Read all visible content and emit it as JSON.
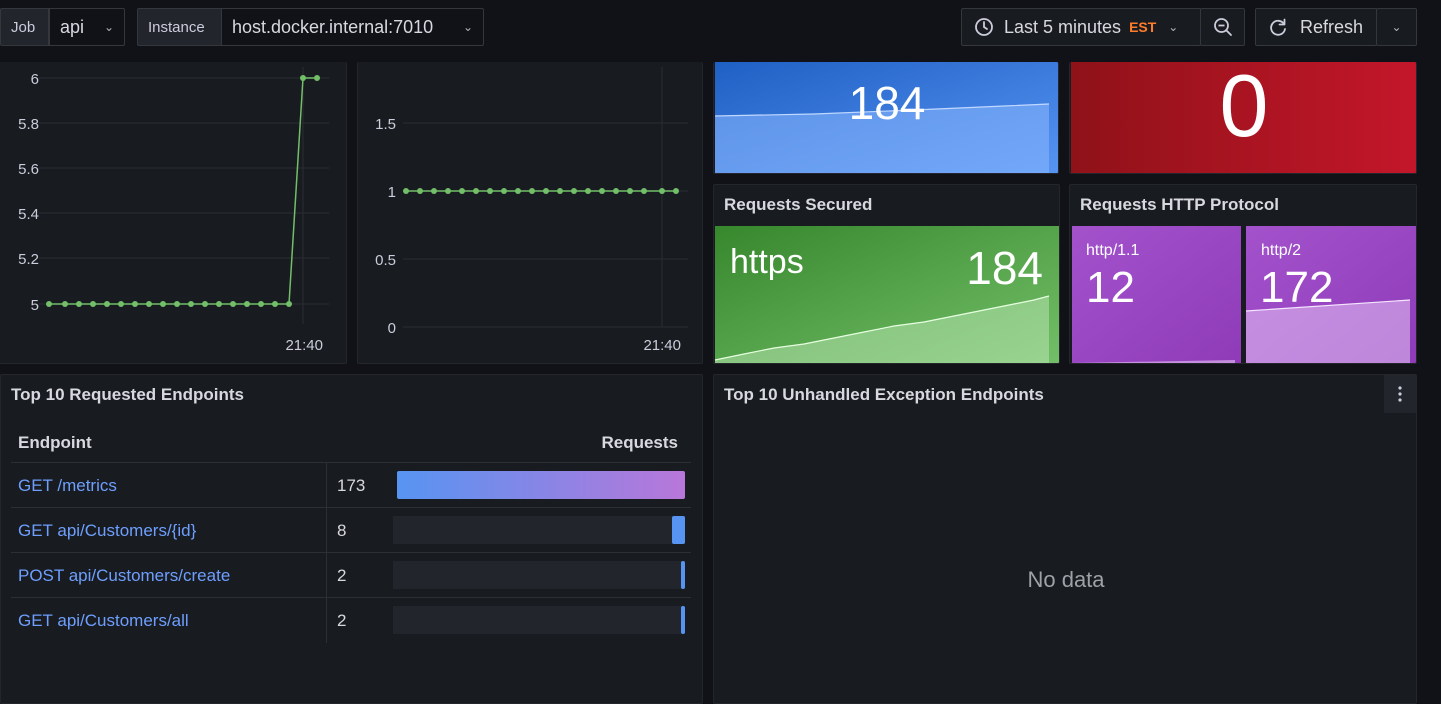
{
  "toolbar": {
    "job_label": "Job",
    "job_value": "api",
    "instance_label": "Instance",
    "instance_value": "host.docker.internal:7010",
    "time_range": "Last 5 minutes",
    "timezone": "EST",
    "refresh_label": "Refresh"
  },
  "panel_left_chart": {
    "y_ticks": [
      "6",
      "5.8",
      "5.6",
      "5.4",
      "5.2",
      "5"
    ],
    "x_tick": "21:40"
  },
  "panel_mid_chart": {
    "y_ticks": [
      "1.5",
      "1",
      "0.5",
      "0"
    ],
    "x_tick": "21:40"
  },
  "stat_total": {
    "value": "184"
  },
  "stat_errors": {
    "value": "0"
  },
  "requests_secured": {
    "title": "Requests Secured",
    "label": "https",
    "value": "184"
  },
  "requests_protocol": {
    "title": "Requests HTTP Protocol",
    "items": [
      {
        "label": "http/1.1",
        "value": "12"
      },
      {
        "label": "http/2",
        "value": "172"
      }
    ]
  },
  "top_requested": {
    "title": "Top 10 Requested Endpoints",
    "col_endpoint": "Endpoint",
    "col_requests": "Requests",
    "rows": [
      {
        "endpoint": "GET /metrics",
        "requests": "173",
        "fraction": 1.0
      },
      {
        "endpoint": "GET api/Customers/{id}",
        "requests": "8",
        "fraction": 0.046
      },
      {
        "endpoint": "POST api/Customers/create",
        "requests": "2",
        "fraction": 0.012
      },
      {
        "endpoint": "GET api/Customers/all",
        "requests": "2",
        "fraction": 0.012
      }
    ]
  },
  "top_exceptions": {
    "title": "Top 10 Unhandled Exception Endpoints",
    "empty_text": "No data"
  },
  "colors": {
    "green_line": "#73bf69",
    "blue_stat": "#3274d9",
    "red_stat": "#c4162a",
    "green_stat": "#56a64b",
    "purple_stat": "#a352cc",
    "accent_orange": "#ff7c2b",
    "link_blue": "#6e9fff"
  }
}
